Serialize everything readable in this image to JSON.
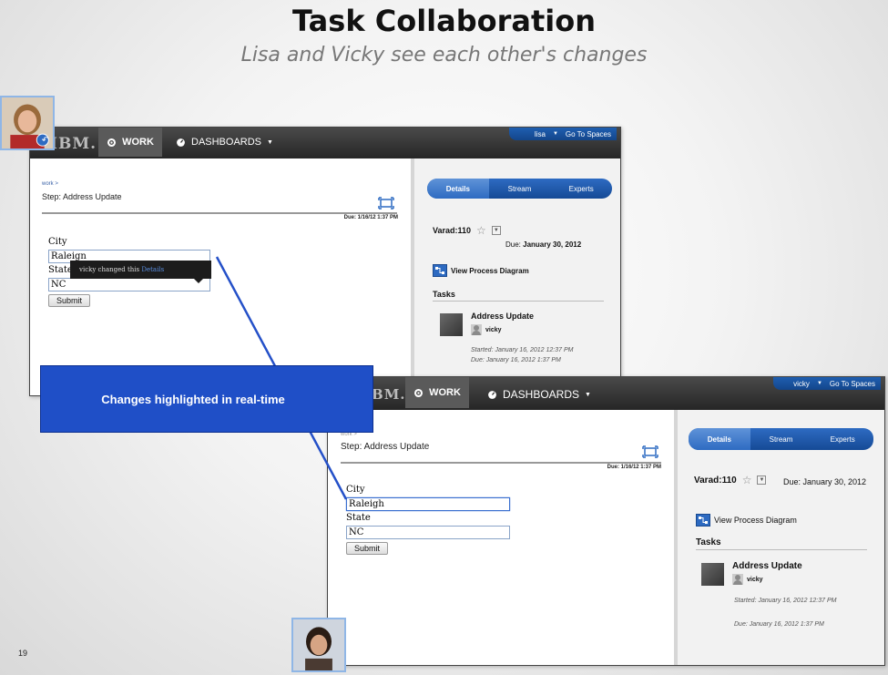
{
  "slide": {
    "title": "Task Collaboration",
    "subtitle": "Lisa and Vicky see each other's changes",
    "number": "19"
  },
  "callout": {
    "text": "Changes highlighted in real-time",
    "color": "#1f4fc7"
  },
  "colors": {
    "topbar": "#262626",
    "accent": "#2e6bc2",
    "callout_line": "#2450c8"
  },
  "lisa_window": {
    "logo": "IBM.",
    "nav": {
      "work": "WORK",
      "dashboards": "DASHBOARDS"
    },
    "user": {
      "name": "lisa",
      "go_to_spaces": "Go To Spaces"
    },
    "breadcrumb": "work >",
    "step_title": "Step: Address Update",
    "due": "Due: 1/16/12 1:37 PM",
    "tooltip": {
      "text": "vicky changed this ",
      "link": "Details"
    },
    "form": {
      "city_label": "City",
      "city_value": "Raleign",
      "state_label": "State",
      "state_value": "NC",
      "submit_label": "Submit"
    },
    "details": {
      "tabs": [
        "Details",
        "Stream",
        "Experts"
      ],
      "instance": "Varad:110",
      "due_prefix": "Due: ",
      "due_date": "January 30, 2012",
      "view_process": "View Process Diagram",
      "tasks_header": "Tasks",
      "task": {
        "name": "Address Update",
        "owner": "vicky",
        "started": "Started: January 16, 2012 12:37 PM",
        "due": "Due: January 16, 2012 1:37 PM"
      }
    }
  },
  "vicky_window": {
    "logo": "IBM.",
    "nav": {
      "work": "WORK",
      "dashboards": "DASHBOARDS"
    },
    "user": {
      "name": "vicky",
      "go_to_spaces": "Go To Spaces"
    },
    "breadcrumb": "work >",
    "step_title": "Step: Address Update",
    "due": "Due: 1/16/12 1:37 PM",
    "form": {
      "city_label": "City",
      "city_value": "Raleigh",
      "state_label": "State",
      "state_value": "NC",
      "submit_label": "Submit"
    },
    "details": {
      "tabs": [
        "Details",
        "Stream",
        "Experts"
      ],
      "instance": "Varad:110",
      "due_text": "Due: January 30, 2012",
      "view_process": "View Process Diagram",
      "tasks_header": "Tasks",
      "task": {
        "name": "Address Update",
        "owner": "vicky",
        "started": "Started: January 16, 2012 12:37 PM",
        "due": "Due: January 16, 2012 1:37 PM"
      }
    }
  },
  "icons": {
    "work": "gear-icon",
    "dashboards": "gauge-icon",
    "expand": "expand-icon",
    "favorite": "star-icon",
    "process": "process-diagram-icon",
    "undo": "undo-icon"
  }
}
